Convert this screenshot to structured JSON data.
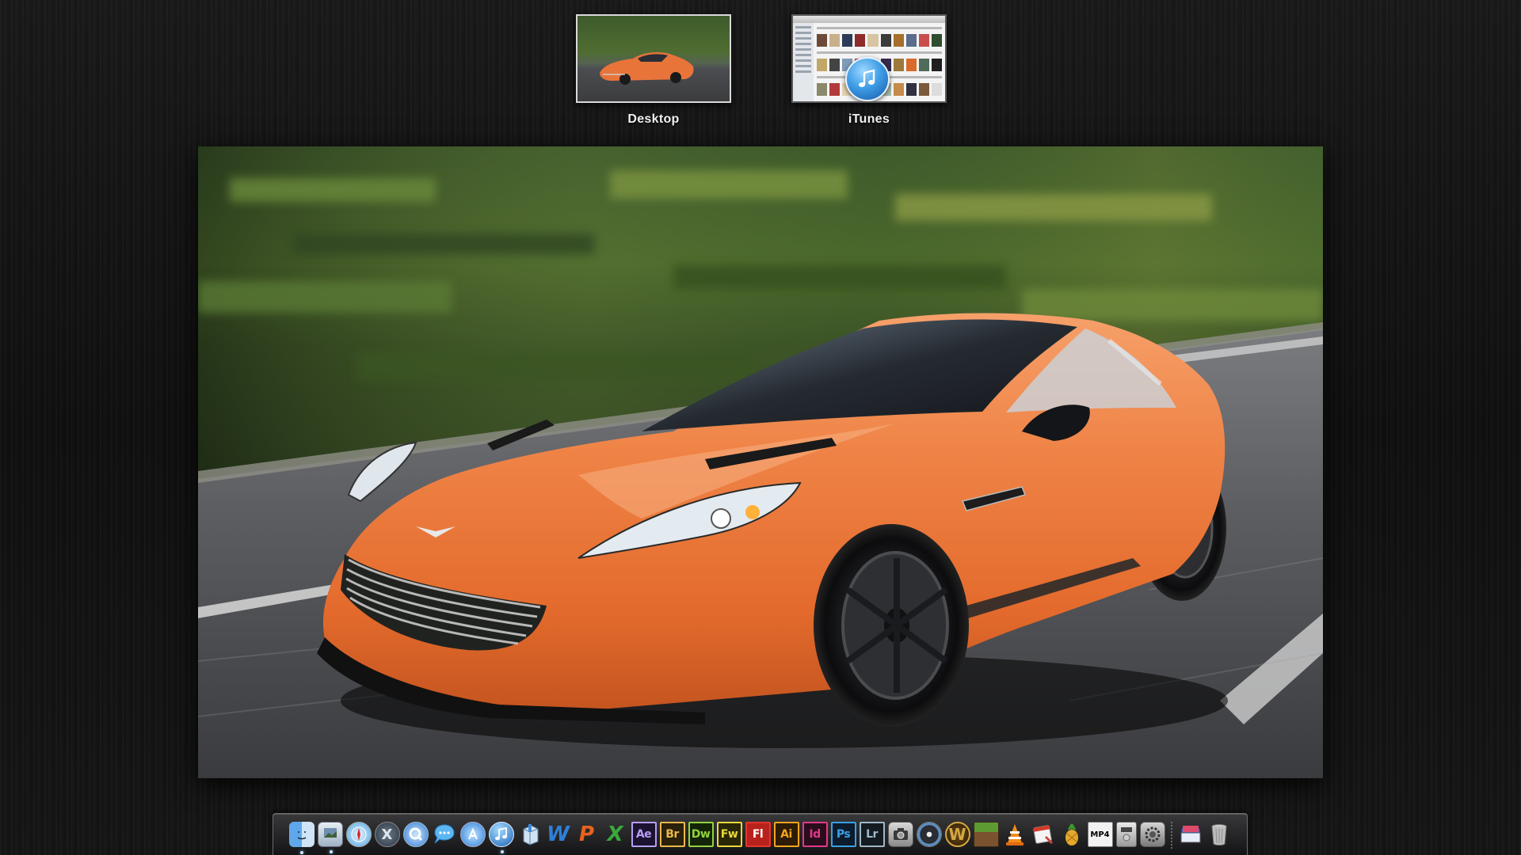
{
  "spaces": [
    {
      "label": "Desktop",
      "active": true
    },
    {
      "label": "iTunes",
      "active": false
    }
  ],
  "dock": {
    "items": [
      {
        "name": "finder",
        "running": true
      },
      {
        "name": "preview",
        "running": true
      },
      {
        "name": "safari",
        "running": false
      },
      {
        "name": "mission-control",
        "running": false
      },
      {
        "name": "quicktime",
        "running": false
      },
      {
        "name": "messages",
        "running": false
      },
      {
        "name": "app-store",
        "running": false
      },
      {
        "name": "itunes",
        "running": true
      },
      {
        "name": "archive-utility",
        "running": false
      },
      {
        "name": "word",
        "glyph": "W",
        "color": "#2f7fd6",
        "running": false
      },
      {
        "name": "powerpoint",
        "glyph": "P",
        "color": "#e8621d",
        "running": false
      },
      {
        "name": "excel",
        "glyph": "X",
        "color": "#39a93b",
        "running": false
      },
      {
        "name": "after-effects",
        "glyph": "Ae",
        "color": "#b79ef7",
        "running": false
      },
      {
        "name": "bridge",
        "glyph": "Br",
        "color": "#e8b94a",
        "running": false
      },
      {
        "name": "dreamweaver",
        "glyph": "Dw",
        "color": "#93d33c",
        "running": false
      },
      {
        "name": "fireworks",
        "glyph": "Fw",
        "color": "#e9d83a",
        "running": false
      },
      {
        "name": "flash",
        "glyph": "Fl",
        "color": "#e2352c",
        "running": false
      },
      {
        "name": "illustrator",
        "glyph": "Ai",
        "color": "#f6a41c",
        "running": false
      },
      {
        "name": "indesign",
        "glyph": "Id",
        "color": "#e2398b",
        "running": false
      },
      {
        "name": "photoshop",
        "glyph": "Ps",
        "color": "#3aa0e6",
        "running": false
      },
      {
        "name": "lightroom",
        "glyph": "Lr",
        "color": "#9fb8c8",
        "running": false
      },
      {
        "name": "image-capture",
        "running": false
      },
      {
        "name": "dvd-disc",
        "running": false
      },
      {
        "name": "world-of-warcraft",
        "glyph": "W",
        "color": "#d4a842",
        "running": false
      },
      {
        "name": "minecraft",
        "running": false
      },
      {
        "name": "vlc",
        "running": false
      },
      {
        "name": "calendar-app",
        "running": false
      },
      {
        "name": "pineapple-app",
        "running": false
      },
      {
        "name": "mp4-tools",
        "glyph": "MP4",
        "color": "#000000",
        "running": false
      },
      {
        "name": "dvd-player",
        "running": false
      },
      {
        "name": "system-preferences",
        "running": false
      },
      {
        "name": "documents-stack",
        "running": false
      },
      {
        "name": "trash",
        "running": false
      }
    ]
  }
}
